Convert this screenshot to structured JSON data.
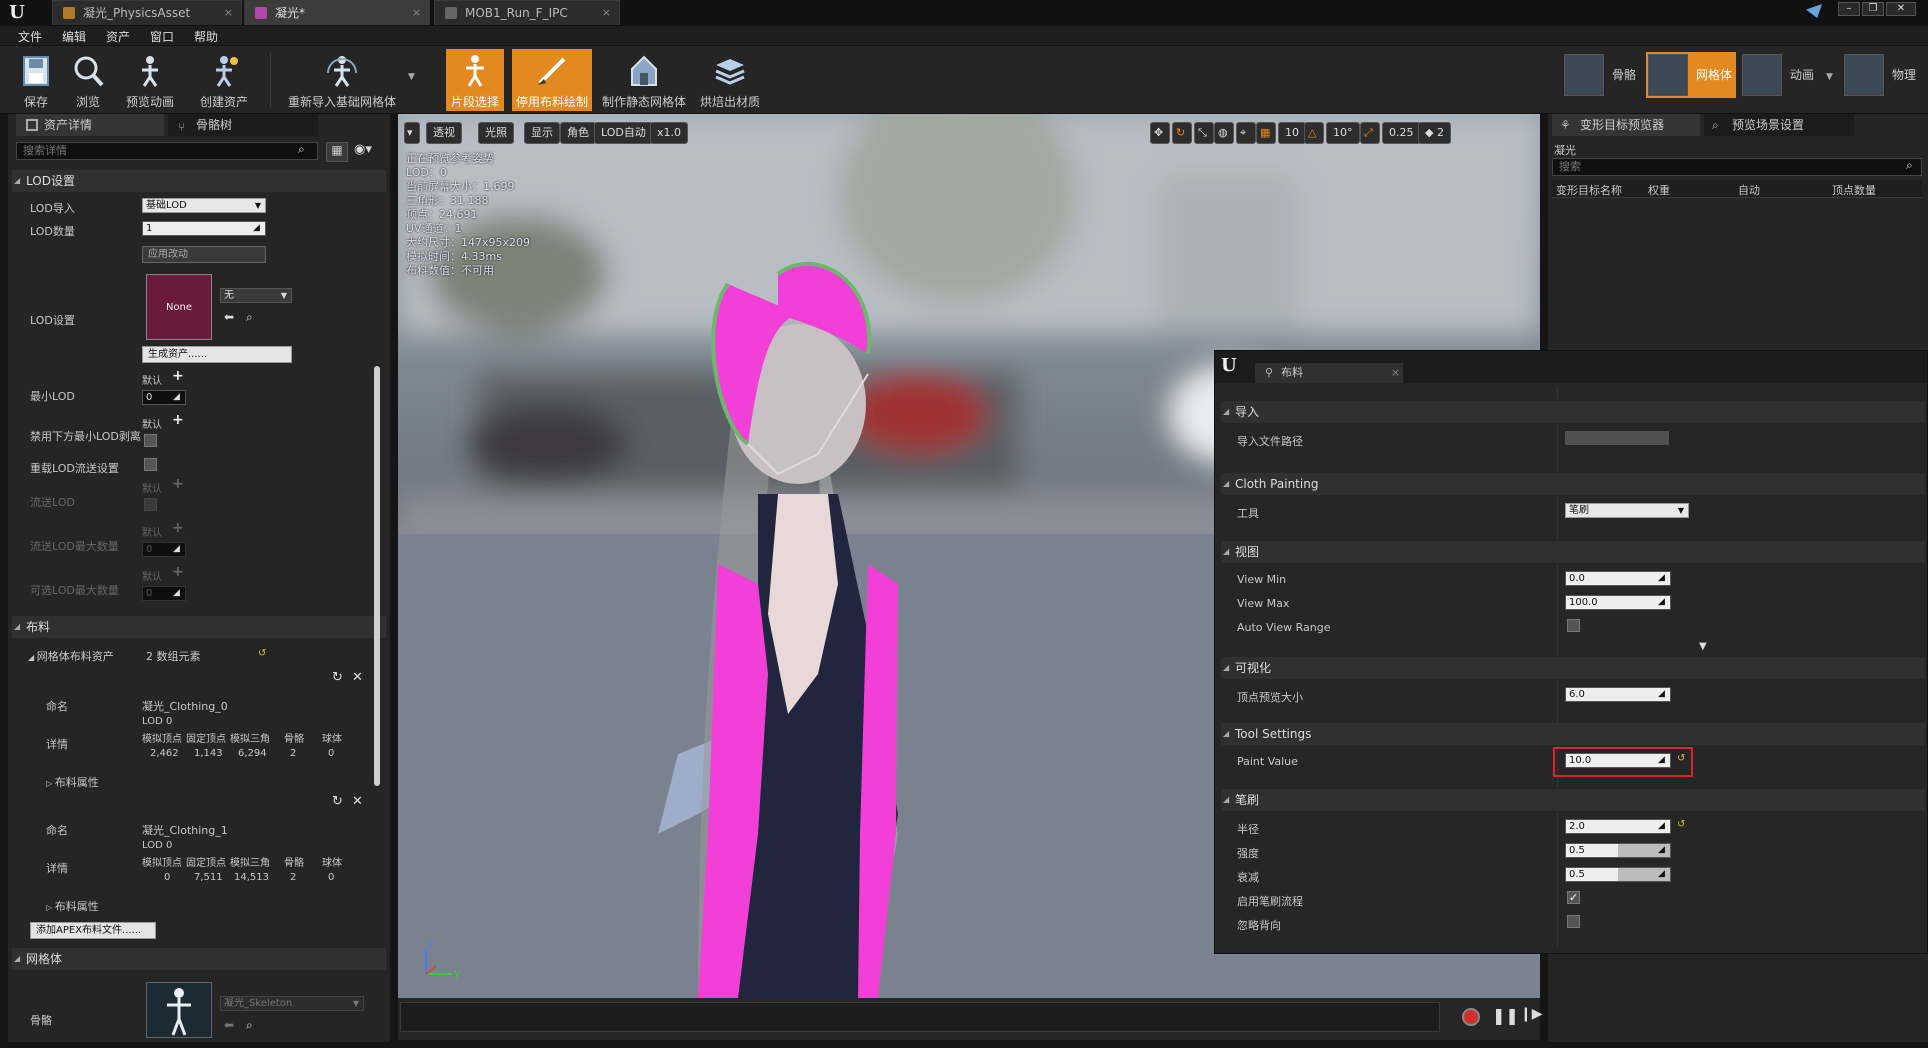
{
  "titlebar": {
    "tabs": [
      {
        "label": "凝光_PhysicsAsset",
        "close": "×"
      },
      {
        "label": "凝光*",
        "close": "×"
      },
      {
        "label": "MOB1_Run_F_IPC",
        "close": "×"
      }
    ],
    "window_controls": [
      "–",
      "❐",
      "✕"
    ]
  },
  "menu": [
    "文件",
    "编辑",
    "资产",
    "窗口",
    "帮助"
  ],
  "toolbar": {
    "buttons": [
      {
        "label": "保存",
        "icon": "save-icon"
      },
      {
        "label": "浏览",
        "icon": "browse-icon"
      },
      {
        "label": "预览动画",
        "icon": "preview-animation-icon"
      },
      {
        "label": "创建资产",
        "icon": "create-asset-icon"
      },
      {
        "label": "重新导入基础网格体",
        "icon": "reimport-icon"
      },
      {
        "label": "片段选择",
        "icon": "section-select-icon",
        "active": true
      },
      {
        "label": "停用布料绘制",
        "icon": "cloth-paint-icon",
        "active": true
      },
      {
        "label": "制作静态网格体",
        "icon": "static-mesh-icon"
      },
      {
        "label": "烘焙出材质",
        "icon": "bake-material-icon"
      }
    ],
    "modes": [
      {
        "label": "骨骼",
        "icon": "skeleton-mode-icon"
      },
      {
        "label": "网格体",
        "icon": "mesh-mode-icon",
        "active": true
      },
      {
        "label": "动画",
        "icon": "animation-mode-icon"
      },
      {
        "label": "物理",
        "icon": "physics-mode-icon"
      }
    ]
  },
  "left_panel": {
    "tabs": [
      "资产详情",
      "骨骼树"
    ],
    "search_placeholder": "搜索详情",
    "lod_section": "LOD设置",
    "lod_import_label": "LOD导入",
    "lod_import_value": "基础LOD",
    "lod_count_label": "LOD数量",
    "lod_count_value": "1",
    "apply_changes": "应用改动",
    "lod_settings_label": "LOD设置",
    "thumb_none": "None",
    "none_dropdown": "无",
    "generate_asset": "生成资产......",
    "min_lod_label": "最小LOD",
    "default_text": "默认",
    "min_lod_value": "0",
    "disable_below_label": "禁用下方最小LOD剥离",
    "override_stream_label": "重载LOD流送设置",
    "stream_lod_label": "流送LOD",
    "stream_max_label": "流送LOD最大数量",
    "stream_max_value": "0",
    "optional_max_label": "可选LOD最大数量",
    "optional_max_value": "0",
    "cloth_section": "布料",
    "mesh_cloth_label": "网格体布料资产",
    "mesh_cloth_value": "2 数组元素",
    "clothing": [
      {
        "name_label": "命名",
        "name": "凝光_Clothing_0",
        "lod": "LOD 0",
        "details_label": "详情",
        "headers": [
          "模拟顶点",
          "固定顶点",
          "模拟三角",
          "骨骼",
          "球体"
        ],
        "values": [
          "2,462",
          "1,143",
          "6,294",
          "2",
          "0"
        ],
        "props": "布料属性"
      },
      {
        "name_label": "命名",
        "name": "凝光_Clothing_1",
        "lod": "LOD 0",
        "details_label": "详情",
        "headers": [
          "模拟顶点",
          "固定顶点",
          "模拟三角",
          "骨骼",
          "球体"
        ],
        "values": [
          "0",
          "7,511",
          "14,513",
          "2",
          "0"
        ],
        "props": "布料属性"
      }
    ],
    "add_apex": "添加APEX布料文件......",
    "mesh_section": "网格体",
    "skeleton_label": "骨骼",
    "skeleton_value": "凝光_Skeleton"
  },
  "viewport": {
    "buttons": [
      "透视",
      "光照",
      "显示",
      "角色",
      "LOD自动",
      "x1.0"
    ],
    "right_values": [
      "10",
      "10°",
      "0.25",
      "2"
    ],
    "info": [
      "正在预览参考姿势",
      "LOD：0",
      "当前屏幕大小：1.699",
      "三角形：31,188",
      "顶点：24,691",
      "UV通道：1",
      "大约尺寸：147x95x209",
      "模拟时间：4.33ms",
      "布料数值：不可用"
    ],
    "axis": {
      "z": "z",
      "y": "y"
    }
  },
  "right_panel": {
    "tabs": [
      "变形目标预览器",
      "预览场景设置"
    ],
    "title": "凝光",
    "search_placeholder": "搜索",
    "columns": [
      "变形目标名称",
      "权重",
      "自动",
      "顶点数量"
    ]
  },
  "cloth_panel": {
    "tab": "布料",
    "import_section": "导入",
    "import_path_label": "导入文件路径",
    "painting_section": "Cloth Painting",
    "tool_label": "工具",
    "tool_value": "笔刷",
    "view_section": "视图",
    "view_min_label": "View Min",
    "view_min_value": "0.0",
    "view_max_label": "View Max",
    "view_max_value": "100.0",
    "auto_range_label": "Auto View Range",
    "vis_section": "可视化",
    "vertex_size_label": "顶点预览大小",
    "vertex_size_value": "6.0",
    "tool_settings_section": "Tool Settings",
    "paint_value_label": "Paint Value",
    "paint_value": "10.0",
    "brush_section": "笔刷",
    "radius_label": "半径",
    "radius_value": "2.0",
    "strength_label": "强度",
    "strength_value": "0.5",
    "falloff_label": "衰减",
    "falloff_value": "0.5",
    "enable_flow_label": "启用笔刷流程",
    "ignore_back_label": "忽略背向"
  },
  "colors": {
    "accent": "#e3891f",
    "cloth_mask": "#f23fd8",
    "highlight_box": "#d22828"
  }
}
